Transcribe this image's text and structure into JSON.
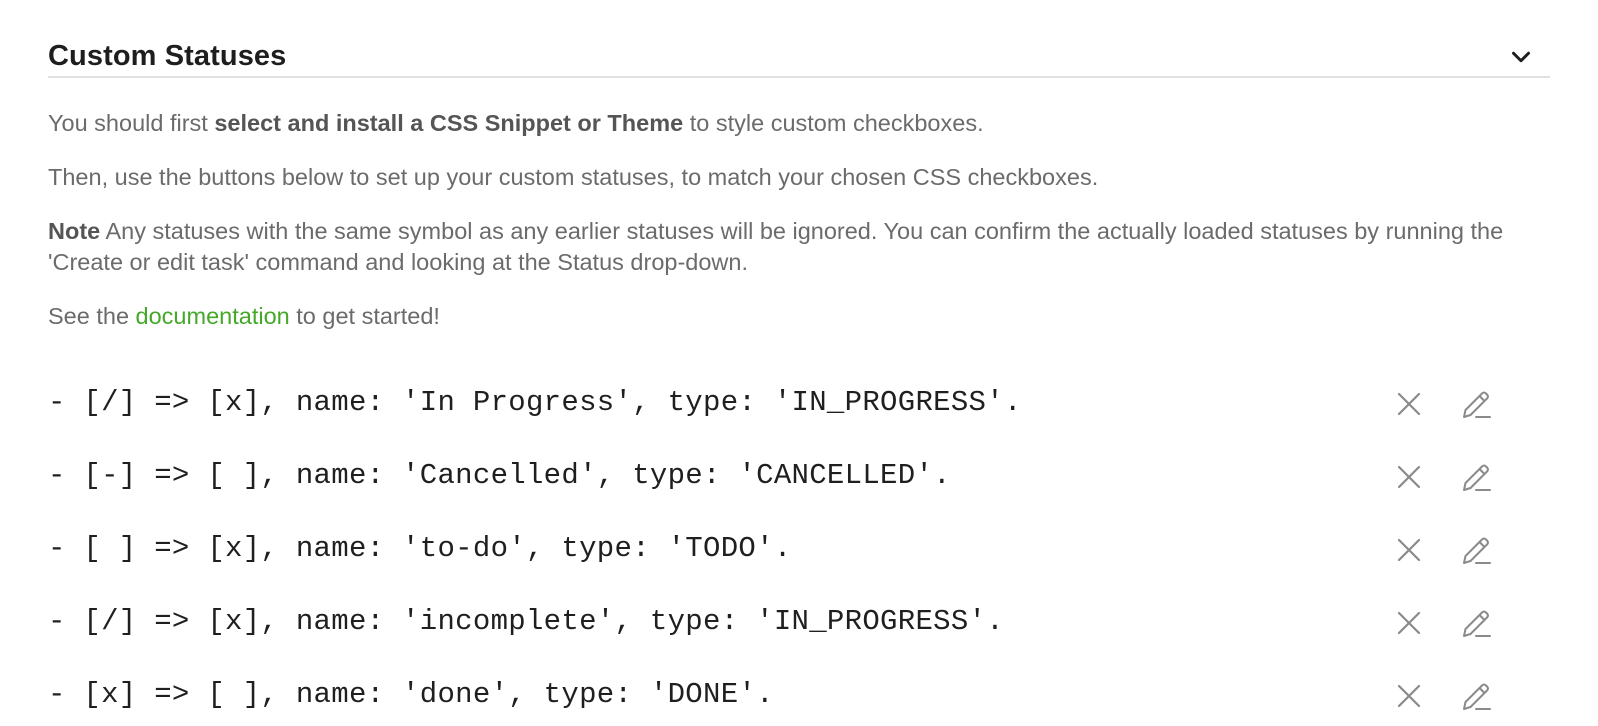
{
  "section": {
    "title": "Custom Statuses"
  },
  "intro": {
    "p1_before": "You should first ",
    "p1_bold": "select and install a CSS Snippet or Theme",
    "p1_after": " to style custom checkboxes.",
    "p2": "Then, use the buttons below to set up your custom statuses, to match your chosen CSS checkboxes.",
    "p3_bold": "Note",
    "p3_rest": " Any statuses with the same symbol as any earlier statuses will be ignored. You can confirm the actually loaded statuses by running the 'Create or edit task' command and looking at the Status drop-down.",
    "p4_before": "See the ",
    "p4_link": "documentation",
    "p4_after": " to get started!"
  },
  "statuses": [
    {
      "text": "- [/] => [x], name: 'In Progress', type: 'IN_PROGRESS'."
    },
    {
      "text": "- [-] => [ ], name: 'Cancelled', type: 'CANCELLED'."
    },
    {
      "text": "- [ ] => [x], name: 'to-do', type: 'TODO'."
    },
    {
      "text": "- [/] => [x], name: 'incomplete', type: 'IN_PROGRESS'."
    },
    {
      "text": "- [x] => [ ], name: 'done', type: 'DONE'."
    }
  ],
  "icons": {
    "collapse": "chevron-down-icon",
    "delete": "close-icon",
    "edit": "pencil-icon"
  },
  "colors": {
    "link": "#44a829",
    "muted_text": "#6b6b6b",
    "icon": "#8a8a8a"
  }
}
